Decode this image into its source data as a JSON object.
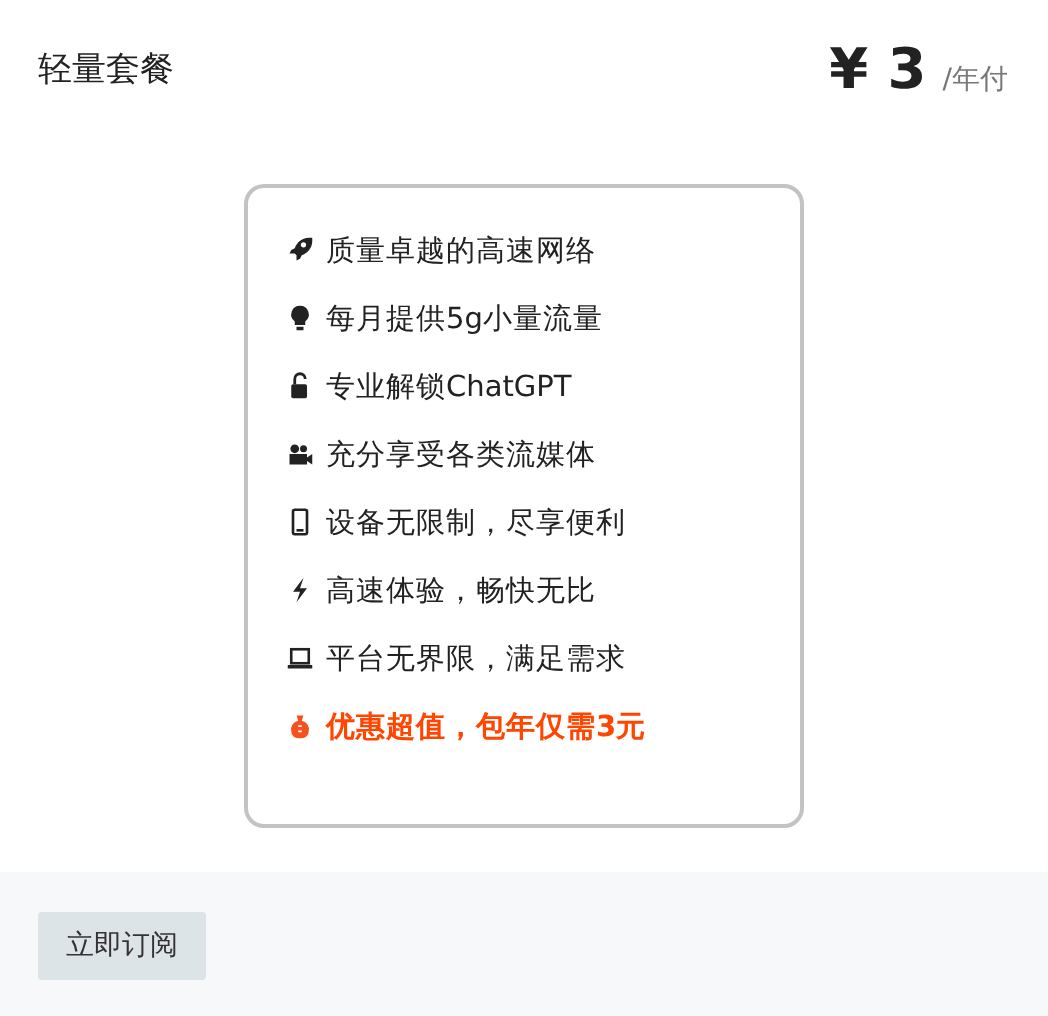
{
  "plan": {
    "title": "轻量套餐",
    "currency": "¥",
    "price": "3",
    "period": "/年付"
  },
  "features": [
    {
      "kind": "rocket",
      "text": "质量卓越的高速网络",
      "highlight": false
    },
    {
      "kind": "bulb",
      "text": "每月提供5g小量流量",
      "highlight": false
    },
    {
      "kind": "unlock",
      "text": "专业解锁ChatGPT",
      "highlight": false
    },
    {
      "kind": "camera",
      "text": "充分享受各类流媒体",
      "highlight": false
    },
    {
      "kind": "phone",
      "text": "设备无限制，尽享便利",
      "highlight": false
    },
    {
      "kind": "bolt",
      "text": "高速体验，畅快无比",
      "highlight": false
    },
    {
      "kind": "laptop",
      "text": "平台无界限，满足需求",
      "highlight": false
    },
    {
      "kind": "moneybag",
      "text": "优惠超值，包年仅需3元",
      "highlight": true
    }
  ],
  "button": {
    "label": "立即订阅"
  }
}
